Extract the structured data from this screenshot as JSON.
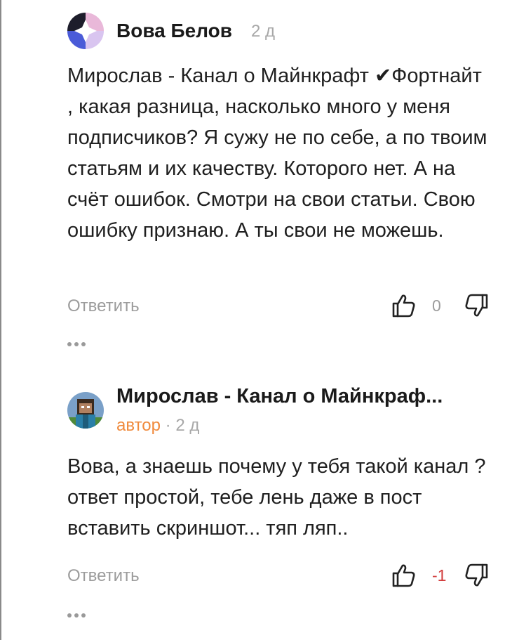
{
  "comments": [
    {
      "author": "Вова Белов",
      "age": "2 д",
      "text": "Мирослав - Канал о Майнкрафт ✔Фортнайт , какая разница, насколько много у меня подписчиков? Я сужу не по себе, а по твоим статьям и их качеству. Которого нет. А на счёт ошибок. Смотри на свои статьи. Свою ошибку признаю. А ты свои не можешь.",
      "reply_label": "Ответить",
      "rating": "0"
    },
    {
      "author": "Мирослав - Канал о Майнкраф...",
      "author_badge": "автор",
      "separator": "·",
      "age": "2 д",
      "text": "Вова, а знаешь почему у тебя такой канал ? ответ простой, тебе лень даже в пост вставить скриншот... тяп ляп..",
      "reply_label": "Ответить",
      "rating": "-1"
    }
  ],
  "icons": {
    "like": "thumbs-up-icon",
    "dislike": "thumbs-down-icon",
    "more": "more-dots-icon"
  },
  "colors": {
    "author_badge": "#f08a3c",
    "negative_rating": "#d23b3b",
    "muted": "#9c9c9c"
  }
}
